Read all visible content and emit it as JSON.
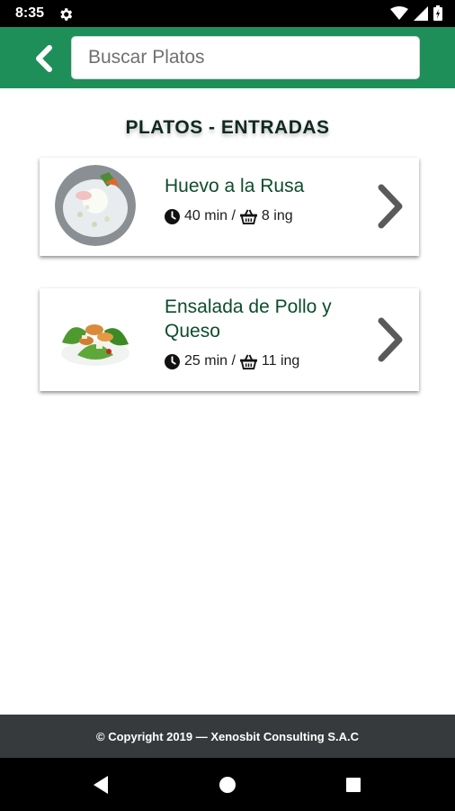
{
  "status_bar": {
    "time": "8:35",
    "icons": [
      "gear-icon",
      "wifi-icon",
      "signal-icon",
      "battery-icon"
    ]
  },
  "header": {
    "back_icon": "chevron-left-icon",
    "search": {
      "placeholder": "Buscar Platos",
      "value": ""
    },
    "color": "#1f8f5a"
  },
  "section": {
    "title": "PLATOS - ENTRADAS"
  },
  "dishes": [
    {
      "name": "Huevo a la Rusa",
      "time": "40 min /",
      "ingredients": "8 ing",
      "image_icon": "egg-salad-photo",
      "chevron_icon": "chevron-right-icon"
    },
    {
      "name": "Ensalada de Pollo y Queso",
      "time": "25 min /",
      "ingredients": "11 ing",
      "image_icon": "chicken-salad-photo",
      "chevron_icon": "chevron-right-icon"
    }
  ],
  "footer": {
    "text": "© Copyright 2019 — Xenosbit Consulting S.A.C"
  },
  "nav_bar": {
    "buttons": [
      "back-triangle-icon",
      "home-circle-icon",
      "recents-square-icon"
    ]
  },
  "colors": {
    "primary": "#1f8f5a",
    "dish_name": "#0d4c2c",
    "footer_bg": "#363a3c",
    "chevron": "#5a5a5a"
  }
}
